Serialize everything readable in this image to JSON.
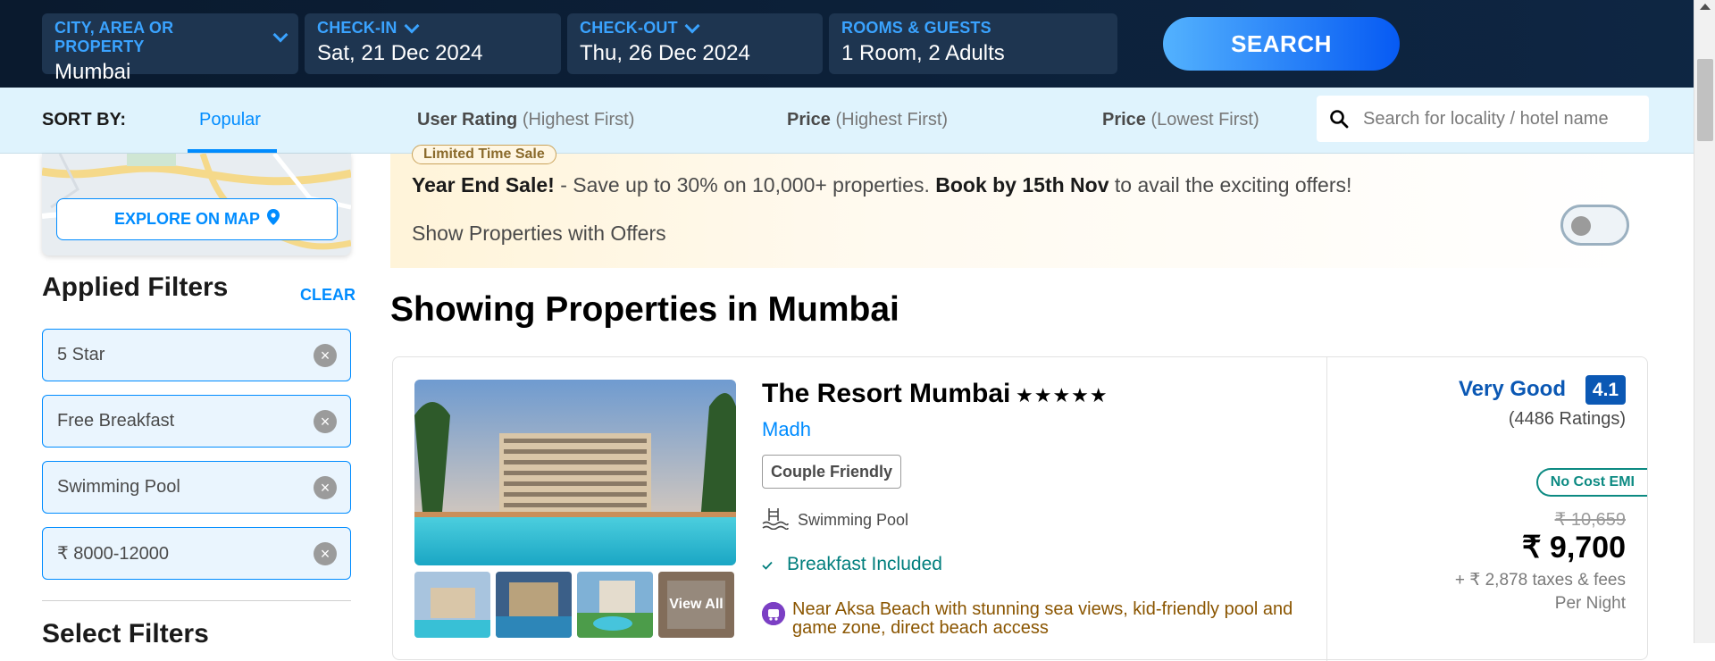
{
  "header": {
    "city": {
      "label": "CITY, AREA OR PROPERTY",
      "value": "Mumbai"
    },
    "checkin": {
      "label": "CHECK-IN",
      "value": "Sat, 21 Dec 2024"
    },
    "checkout": {
      "label": "CHECK-OUT",
      "value": "Thu, 26 Dec 2024"
    },
    "guests": {
      "label": "ROOMS & GUESTS",
      "value": "1 Room, 2 Adults"
    },
    "search_label": "SEARCH"
  },
  "sort": {
    "label": "SORT BY:",
    "options": [
      {
        "main": "Popular",
        "sub": ""
      },
      {
        "main": "User Rating",
        "sub": "(Highest First)"
      },
      {
        "main": "Price",
        "sub": "(Highest First)"
      },
      {
        "main": "Price",
        "sub": "(Lowest First)"
      }
    ],
    "active_index": 0,
    "search_placeholder": "Search for locality / hotel name"
  },
  "sidebar": {
    "explore_label": "EXPLORE ON MAP",
    "applied_title": "Applied Filters",
    "clear_label": "CLEAR",
    "filters": [
      "5 Star",
      "Free Breakfast",
      "Swimming Pool",
      "₹ 8000-12000"
    ],
    "select_title": "Select Filters"
  },
  "banner": {
    "tag": "Limited Time Sale",
    "headline": "Year End Sale!",
    "text_1": " - Save up to 30% on 10,000+ properties. ",
    "highlight": "Book by 15th Nov",
    "text_2": " to avail the exciting offers!",
    "offers_label": "Show Properties with Offers",
    "offers_toggle_on": false
  },
  "main": {
    "heading": "Showing Properties in Mumbai"
  },
  "hotel": {
    "name": "The Resort Mumbai",
    "stars": "★★★★★",
    "locality": "Madh",
    "tag": "Couple Friendly",
    "amenity": "Swimming Pool",
    "breakfast": "Breakfast Included",
    "near": "Near Aksa Beach with stunning sea views, kid-friendly pool and game zone, direct beach access",
    "view_all": "View All",
    "rating_word": "Very Good",
    "rating_value": "4.1",
    "rating_count": "(4486 Ratings)",
    "emi": "No Cost EMI",
    "old_price": "₹ 10,659",
    "price": "₹ 9,700",
    "taxes": "+ ₹ 2,878 taxes & fees",
    "per_night": "Per Night"
  },
  "colors": {
    "accent": "#008cff",
    "header_bg": "#0e2643",
    "sort_bg": "#dff3fd",
    "rating_blue": "#0b58b4",
    "teal": "#007e7d"
  }
}
